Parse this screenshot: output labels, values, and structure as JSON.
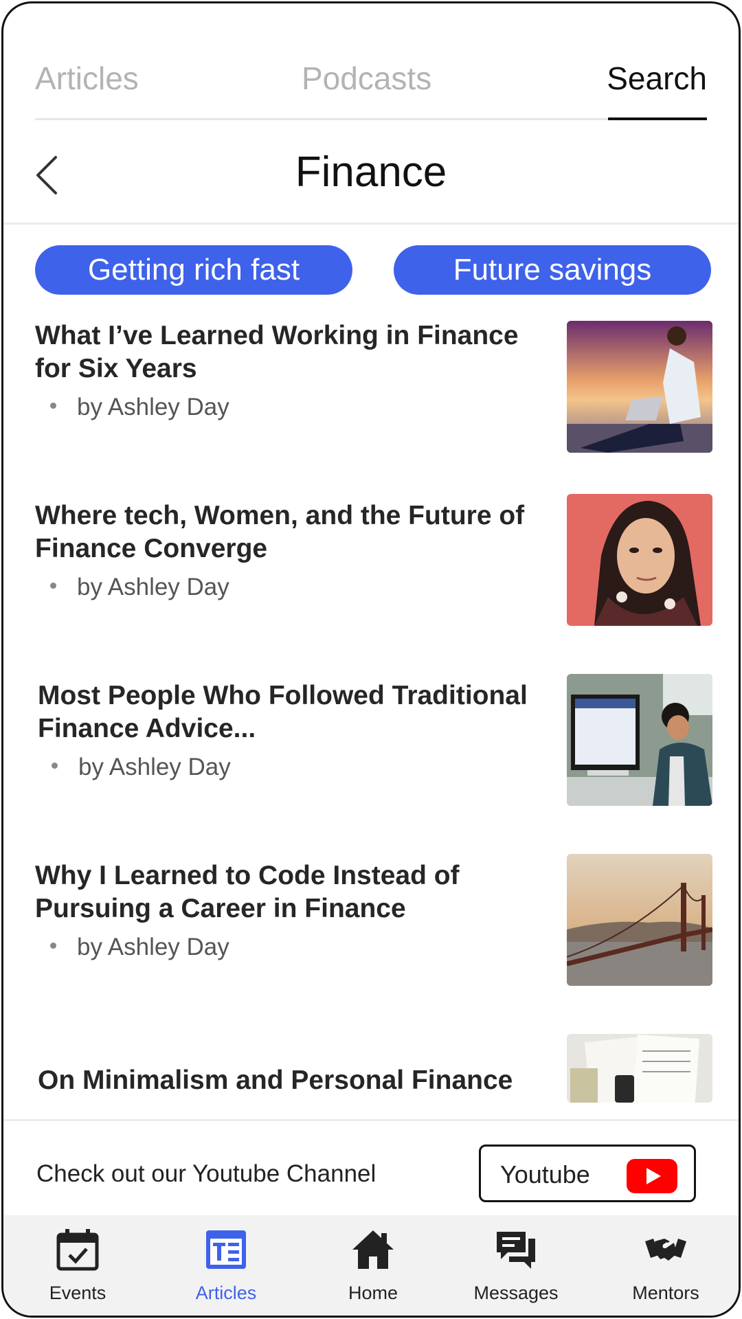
{
  "top_tabs": {
    "articles": "Articles",
    "podcasts": "Podcasts",
    "search": "Search",
    "active": "Search"
  },
  "header": {
    "title": "Finance",
    "back_icon": "chevron-left-icon"
  },
  "chips": [
    {
      "label": "Getting rich fast"
    },
    {
      "label": "Future savings"
    }
  ],
  "articles": [
    {
      "title": "What I’ve Learned Working in Finance for Six Years",
      "author": "by Ashley Day",
      "image": "man-with-laptop-sunset"
    },
    {
      "title": "Where tech, Women, and the Future of Finance Converge",
      "author": "by Ashley Day",
      "image": "woman-headscarf-portrait"
    },
    {
      "title": "Most People Who Followed Traditional Finance Advice...",
      "author": "by Ashley Day",
      "image": "man-at-desk-computer"
    },
    {
      "title": "Why I Learned to Code Instead of Pursuing a Career in Finance",
      "author": "by Ashley Day",
      "image": "golden-gate-bridge"
    },
    {
      "title": "On Minimalism and Personal Finance",
      "author": "",
      "image": "tax-papers-calculator"
    }
  ],
  "youtube_banner": {
    "text": "Check out our Youtube Channel",
    "button_label": "Youtube",
    "logo_icon": "youtube-play-icon",
    "logo_color": "#ff0000"
  },
  "bottom_nav": [
    {
      "label": "Events",
      "icon": "calendar-check-icon",
      "active": false
    },
    {
      "label": "Articles",
      "icon": "article-icon",
      "active": true
    },
    {
      "label": "Home",
      "icon": "home-icon",
      "active": false
    },
    {
      "label": "Messages",
      "icon": "chat-bubbles-icon",
      "active": false
    },
    {
      "label": "Mentors",
      "icon": "handshake-icon",
      "active": false
    }
  ],
  "colors": {
    "accent": "#3f62ea",
    "inactive_tab": "#b3b3b3",
    "nav_background": "#f2f2f2"
  }
}
